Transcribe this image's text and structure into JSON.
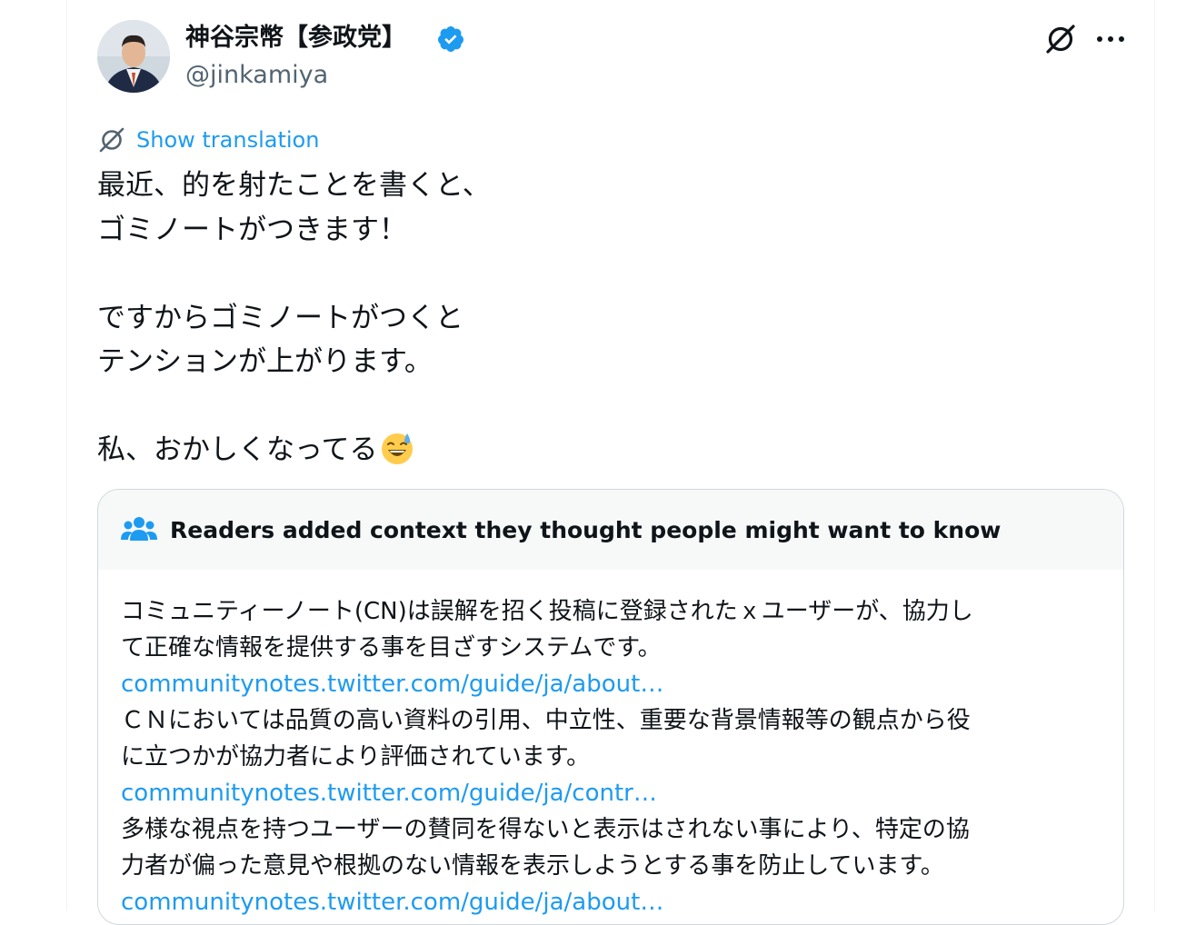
{
  "author": {
    "display_name": "神谷宗幣【参政党】",
    "handle": "@jinkamiya",
    "avatar_icon": "avatar-photo",
    "verified_color": "#1d9bf0"
  },
  "actions": {
    "grok_icon": "grok-icon",
    "more_icon": "more-icon"
  },
  "translation": {
    "label": "Show translation",
    "icon": "grok-icon"
  },
  "tweet": {
    "lines": [
      "最近、的を射たことを書くと、",
      "ゴミノートがつきます！",
      "",
      "ですからゴミノートがつくと",
      "テンションが上がります。",
      "",
      "私、おかしくなってる"
    ],
    "emoji": "grinning-face-with-sweat"
  },
  "community_note": {
    "header_icon": "people-icon",
    "title": "Readers added context they thought people might want to know",
    "body": [
      {
        "type": "text",
        "value": "コミュニティーノート(CN)は誤解を招く投稿に登録されたｘユーザーが、協力し"
      },
      {
        "type": "text",
        "value": "て正確な情報を提供する事を目ざすシステムです。"
      },
      {
        "type": "link",
        "value": "communitynotes.twitter.com/guide/ja/about…"
      },
      {
        "type": "text",
        "value": "ＣＮにおいては品質の高い資料の引用、中立性、重要な背景情報等の観点から役"
      },
      {
        "type": "text",
        "value": "に立つかが協力者により評価されています。"
      },
      {
        "type": "link",
        "value": "communitynotes.twitter.com/guide/ja/contr…"
      },
      {
        "type": "text",
        "value": "多様な視点を持つユーザーの賛同を得ないと表示はされない事により、特定の協"
      },
      {
        "type": "text",
        "value": "力者が偏った意見や根拠のない情報を表示しようとする事を防止しています。"
      },
      {
        "type": "link",
        "value": "communitynotes.twitter.com/guide/ja/about…"
      }
    ]
  },
  "colors": {
    "text": "#0f1419",
    "secondary": "#536471",
    "accent": "#1d9bf0",
    "note_header_bg": "#f7f9f9",
    "border": "#cfd9de"
  }
}
